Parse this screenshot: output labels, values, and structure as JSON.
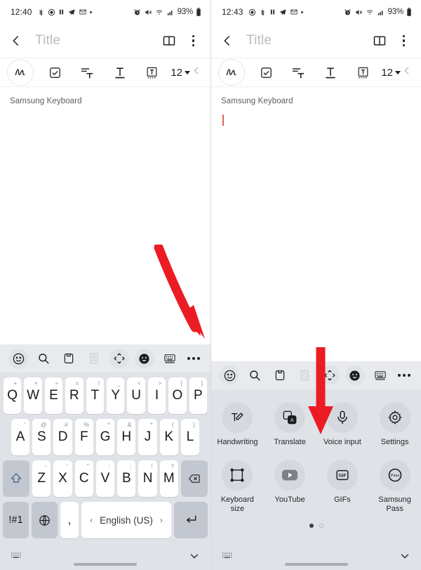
{
  "panels": [
    {
      "status": {
        "time": "12:40",
        "battery": "93%"
      },
      "appbar": {
        "title": "Title"
      },
      "format": {
        "size": "12"
      },
      "note": {
        "line": "Samsung Keyboard",
        "caret_visible": false
      },
      "keyboard_mode": "keys"
    },
    {
      "status": {
        "time": "12:43",
        "battery": "93%"
      },
      "appbar": {
        "title": "Title"
      },
      "format": {
        "size": "12"
      },
      "note": {
        "line": "Samsung Keyboard",
        "caret_visible": true
      },
      "keyboard_mode": "menu"
    }
  ],
  "status_icons": [
    "bluetooth-icon",
    "record-icon",
    "pause-icon",
    "telegram-icon",
    "gmail-icon",
    "dot-icon"
  ],
  "status_right_icons": [
    "alarm-icon",
    "mute-icon",
    "wifi-icon",
    "signal-icon"
  ],
  "appbar_icons": {
    "back": "chevron-left-icon",
    "book": "reading-mode-icon",
    "menu": "kebab-menu-icon"
  },
  "format_toolbar": {
    "items": [
      {
        "name": "handwriting-pen-icon",
        "label": ""
      },
      {
        "name": "checkbox-icon",
        "label": ""
      },
      {
        "name": "text-align-icon",
        "label": ""
      },
      {
        "name": "underline-text-icon",
        "label": ""
      },
      {
        "name": "text-box-icon",
        "label": ""
      }
    ],
    "size_label": "12",
    "undo_icon": "undo-arrow-icon"
  },
  "keyboard_toolbar": {
    "items": [
      "emoji-icon",
      "search-icon",
      "clipboard-icon",
      "calculator-icon",
      "move-keyboard-icon",
      "sticker-icon",
      "keyboard-mode-icon"
    ],
    "more_label": "more-options-icon"
  },
  "keyboard": {
    "row1": [
      {
        "key": "Q",
        "sub": "+"
      },
      {
        "key": "W",
        "sub": "×"
      },
      {
        "key": "E",
        "sub": "÷"
      },
      {
        "key": "R",
        "sub": "="
      },
      {
        "key": "T",
        "sub": "/"
      },
      {
        "key": "Y",
        "sub": "_"
      },
      {
        "key": "U",
        "sub": "<"
      },
      {
        "key": "I",
        "sub": ">"
      },
      {
        "key": "O",
        "sub": "["
      },
      {
        "key": "P",
        "sub": "]"
      }
    ],
    "row2": [
      {
        "key": "A",
        "sub": "'"
      },
      {
        "key": "S",
        "sub": "@"
      },
      {
        "key": "D",
        "sub": "#"
      },
      {
        "key": "F",
        "sub": "%"
      },
      {
        "key": "G",
        "sub": "^"
      },
      {
        "key": "H",
        "sub": "&"
      },
      {
        "key": "J",
        "sub": "*"
      },
      {
        "key": "K",
        "sub": "("
      },
      {
        "key": "L",
        "sub": ")"
      }
    ],
    "row3": [
      {
        "key": "Z",
        "sub": "-"
      },
      {
        "key": "X",
        "sub": "'"
      },
      {
        "key": "C",
        "sub": "\""
      },
      {
        "key": "V",
        "sub": ":"
      },
      {
        "key": "B",
        "sub": ";"
      },
      {
        "key": "N",
        "sub": "!"
      },
      {
        "key": "M",
        "sub": "?"
      }
    ],
    "shift_icon": "shift-arrow-icon",
    "backspace_icon": "backspace-icon",
    "symbols_label": "!#1",
    "globe_icon": "language-globe-icon",
    "comma_label": ",",
    "space_label": "English (US)",
    "space_prev": "‹",
    "space_next": "›",
    "enter_icon": "enter-return-icon"
  },
  "panel_menu": {
    "rows": [
      [
        {
          "label": "Handwriting",
          "icon": "handwriting-icon"
        },
        {
          "label": "Translate",
          "icon": "translate-icon"
        },
        {
          "label": "Voice input",
          "icon": "microphone-icon"
        },
        {
          "label": "Settings",
          "icon": "gear-icon"
        }
      ],
      [
        {
          "label": "Keyboard size",
          "icon": "resize-keyboard-icon"
        },
        {
          "label": "YouTube",
          "icon": "youtube-icon"
        },
        {
          "label": "GIFs",
          "icon": "gif-icon"
        },
        {
          "label": "Samsung Pass",
          "icon": "samsung-pass-icon"
        }
      ]
    ],
    "pages": 2,
    "active_page": 1
  },
  "navbar": {
    "keyboard_icon": "mini-keyboard-icon",
    "collapse_icon": "chevron-down-icon"
  },
  "annotations": [
    {
      "name": "arrow-to-more-options",
      "color": "#ec1c24",
      "direction": "diagonal-down-right"
    },
    {
      "name": "arrow-to-page-dots",
      "color": "#ec1c24",
      "direction": "down"
    }
  ],
  "colors": {
    "accent_red": "#ec1c24",
    "caret": "#e8614f",
    "keyboard_bg": "#dfe2e7",
    "key_bg": "#ffffff",
    "fn_key_bg": "#c3c8d0"
  }
}
